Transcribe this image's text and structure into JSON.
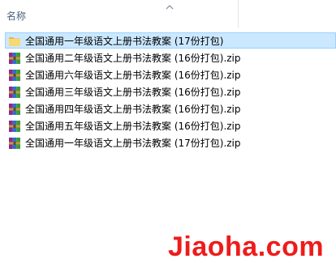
{
  "header": {
    "name_label": "名称",
    "sort_icon": "chevron-up-icon"
  },
  "files": [
    {
      "name": "全国通用一年级语文上册书法教案 (17份打包)",
      "type": "folder",
      "icon": "folder-icon",
      "selected": true
    },
    {
      "name": "全国通用二年级语文上册书法教案 (16份打包).zip",
      "type": "zip",
      "icon": "archive-icon",
      "selected": false
    },
    {
      "name": "全国通用六年级语文上册书法教案 (16份打包).zip",
      "type": "zip",
      "icon": "archive-icon",
      "selected": false
    },
    {
      "name": "全国通用三年级语文上册书法教案 (16份打包).zip",
      "type": "zip",
      "icon": "archive-icon",
      "selected": false
    },
    {
      "name": "全国通用四年级语文上册书法教案 (16份打包).zip",
      "type": "zip",
      "icon": "archive-icon",
      "selected": false
    },
    {
      "name": "全国通用五年级语文上册书法教案 (16份打包).zip",
      "type": "zip",
      "icon": "archive-icon",
      "selected": false
    },
    {
      "name": "全国通用一年级语文上册书法教案 (17份打包).zip",
      "type": "zip",
      "icon": "archive-icon",
      "selected": false
    }
  ],
  "watermark": "Jiaoha.com",
  "colors": {
    "selection_bg": "#cce8ff",
    "selection_border": "#99d1ff",
    "folder": "#f8d775",
    "watermark": "#ef1b1b"
  }
}
